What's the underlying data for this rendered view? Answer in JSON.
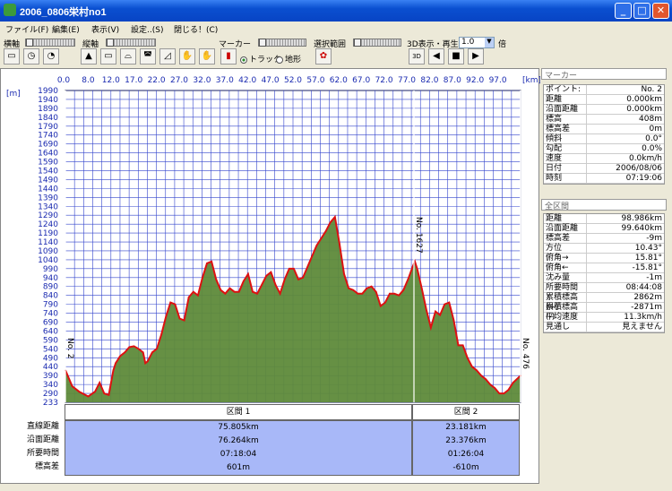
{
  "window": {
    "title": "2006_0806栄村no1"
  },
  "menu": [
    "ファイル(F)",
    "編集(E)",
    "表示(V)",
    "設定..(S)",
    "閉じる！(C)"
  ],
  "toolbar": {
    "horizontal_label": "横軸",
    "vertical_label": "縦軸",
    "marker_label": "マーカー",
    "range_label": "選択範囲",
    "display3d_label": "3D表示・再生",
    "speed_value": "1.0",
    "speed_unit": "倍",
    "track_label": "トラック",
    "terrain_label": "地形",
    "btn_3d": "3D"
  },
  "chart_data": {
    "type": "area",
    "xlabel": "[km]",
    "ylabel": "[m]",
    "xlim": [
      0,
      99.64
    ],
    "ylim": [
      233,
      1990
    ],
    "x_ticks": [
      "0.0",
      "8.0",
      "12.0",
      "17.0",
      "22.0",
      "27.0",
      "32.0",
      "37.0",
      "42.0",
      "47.0",
      "52.0",
      "57.0",
      "62.0",
      "67.0",
      "72.0",
      "77.0",
      "82.0",
      "87.0",
      "92.0",
      "97.0"
    ],
    "y_ticks": [
      "1990",
      "1940",
      "1890",
      "1840",
      "1790",
      "1740",
      "1690",
      "1640",
      "1590",
      "1540",
      "1490",
      "1440",
      "1390",
      "1340",
      "1290",
      "1240",
      "1190",
      "1140",
      "1090",
      "1040",
      "990",
      "940",
      "890",
      "840",
      "790",
      "740",
      "690",
      "640",
      "590",
      "540",
      "490",
      "440",
      "390",
      "340",
      "290",
      "233"
    ],
    "markers": [
      {
        "label": "No. 2",
        "x": 0.0
      },
      {
        "label": "No. 1627",
        "x": 76.3
      },
      {
        "label": "No. 476",
        "x": 99.6
      }
    ],
    "series": [
      {
        "color": "#dd1111",
        "x": [
          0,
          1.5,
          3,
          5,
          6.5,
          7.5,
          8.5,
          9.5,
          10.5,
          11,
          12,
          13,
          14,
          15,
          16,
          17,
          17.5,
          18,
          19,
          20,
          21,
          22,
          23,
          24,
          25,
          26,
          27,
          28,
          29,
          30,
          31,
          32,
          33,
          34,
          35,
          36,
          37,
          38,
          39,
          40,
          41,
          42,
          43,
          44,
          45,
          46,
          47,
          48,
          49,
          50,
          51,
          52,
          53,
          54,
          55,
          56,
          57,
          58,
          59,
          60,
          61,
          62,
          63,
          64,
          65,
          66,
          67,
          68,
          69,
          70,
          71,
          72,
          73,
          74,
          75,
          76,
          76.5,
          77,
          78,
          79,
          80,
          81,
          82,
          83,
          84,
          85,
          86,
          87,
          88,
          89,
          90,
          91,
          92,
          93,
          94,
          95,
          96,
          97,
          98,
          99.64
        ],
        "y": [
          420,
          330,
          300,
          270,
          300,
          350,
          290,
          280,
          420,
          460,
          500,
          520,
          550,
          555,
          540,
          520,
          460,
          470,
          520,
          540,
          620,
          720,
          800,
          790,
          710,
          700,
          830,
          860,
          840,
          940,
          1020,
          1030,
          930,
          870,
          850,
          880,
          860,
          860,
          920,
          960,
          860,
          850,
          900,
          950,
          970,
          900,
          850,
          930,
          990,
          990,
          930,
          940,
          1000,
          1060,
          1120,
          1160,
          1200,
          1250,
          1280,
          1130,
          960,
          880,
          870,
          850,
          850,
          880,
          890,
          860,
          780,
          800,
          850,
          850,
          840,
          870,
          930,
          1000,
          1030,
          990,
          880,
          760,
          660,
          750,
          730,
          790,
          800,
          700,
          560,
          560,
          490,
          440,
          420,
          390,
          370,
          340,
          320,
          290,
          290,
          310,
          350,
          390
        ]
      }
    ]
  },
  "panel": {
    "marker_title": "マーカー",
    "marker_rows": [
      {
        "k": "ポイント:",
        "v": "No. 2"
      },
      {
        "k": "距離",
        "v": "0.000km"
      },
      {
        "k": "沿面距離",
        "v": "0.000km"
      },
      {
        "k": "標高",
        "v": "408m"
      },
      {
        "k": "標高差",
        "v": "0m"
      },
      {
        "k": "傾斜",
        "v": "0.0°"
      },
      {
        "k": "勾配",
        "v": "0.0%"
      },
      {
        "k": "速度",
        "v": "0.0km/h"
      },
      {
        "k": "日付",
        "v": "2006/08/06"
      },
      {
        "k": "時刻",
        "v": "07:19:06"
      }
    ],
    "total_title": "全区間",
    "total_rows": [
      {
        "k": "距離",
        "v": "98.986km"
      },
      {
        "k": "沿面距離",
        "v": "99.640km"
      },
      {
        "k": "標高差",
        "v": "-9m"
      },
      {
        "k": "方位",
        "v": "10.43°"
      },
      {
        "k": "俯角→",
        "v": "15.81°"
      },
      {
        "k": "俯角←",
        "v": "-15.81°"
      },
      {
        "k": "沈み量",
        "v": "-1m"
      },
      {
        "k": "所要時間",
        "v": "08:44:08"
      },
      {
        "k": "累積標高(+)",
        "v": "2862m"
      },
      {
        "k": "累積標高(-)",
        "v": "-2871m"
      },
      {
        "k": "平均速度",
        "v": "11.3km/h"
      },
      {
        "k": "見通し",
        "v": "見えません"
      }
    ]
  },
  "summary": {
    "row_labels": [
      "直線距離",
      "沿面距離",
      "所要時間",
      "標高差"
    ],
    "sections": [
      {
        "name": "区間 1",
        "values": [
          "75.805km",
          "76.264km",
          "07:18:04",
          "601m"
        ]
      },
      {
        "name": "区間 2",
        "values": [
          "23.181km",
          "23.376km",
          "01:26:04",
          "-610m"
        ]
      }
    ]
  }
}
